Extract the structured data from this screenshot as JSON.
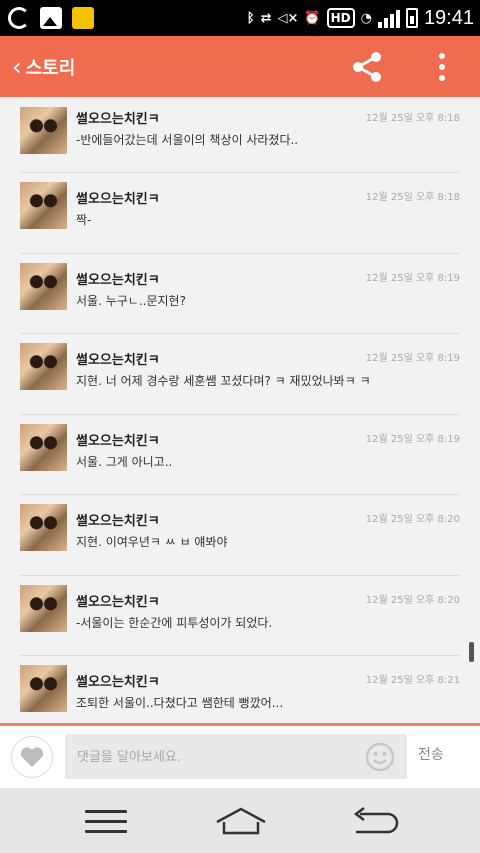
{
  "status_bar": {
    "hd_label": "HD",
    "time": "19:41",
    "icons": [
      "o-app-icon",
      "gallery-icon",
      "memo-icon",
      "bluetooth-icon",
      "nfc-icon",
      "mute-icon",
      "alarm-icon",
      "hd-icon",
      "wifi-icon",
      "signal-icon",
      "battery-charging-icon"
    ]
  },
  "app_bar": {
    "back_label": "스토리",
    "back_chevron": "‹",
    "share_icon": "share-icon",
    "more_icon": "more-vertical-icon"
  },
  "colors": {
    "accent": "#f06c4e",
    "background": "#f2f2f2"
  },
  "comments": [
    {
      "author": "썰오으는치킨ㅋ",
      "time": "12월 25일 오후 8:18",
      "text": "-반에들어갔는데 서울이의 책상이 사라졌다.."
    },
    {
      "author": "썰오으는치킨ㅋ",
      "time": "12월 25일 오후 8:18",
      "text": "짝-"
    },
    {
      "author": "썰오으는치킨ㅋ",
      "time": "12월 25일 오후 8:19",
      "text": "서울. 누구ㄴ..문지현?"
    },
    {
      "author": "썰오으는치킨ㅋ",
      "time": "12월 25일 오후 8:19",
      "text": "지현. 너 어제 경수랑 세훈쌤 꼬셨다며? ㅋ 재밌었나봐ㅋ ㅋ"
    },
    {
      "author": "썰오으는치킨ㅋ",
      "time": "12월 25일 오후 8:19",
      "text": "서울. 그게 아니고.."
    },
    {
      "author": "썰오으는치킨ㅋ",
      "time": "12월 25일 오후 8:20",
      "text": "지현. 이여우년ㅋ ㅆ ㅂ  얘봐야"
    },
    {
      "author": "썰오으는치킨ㅋ",
      "time": "12월 25일 오후 8:20",
      "text": "-서울이는 한순간에 피투성이가 되었다."
    },
    {
      "author": "썰오으는치킨ㅋ",
      "time": "12월 25일 오후 8:21",
      "text": "조퇴한 서울이..다쳤다고 쌤한테 뻥깠어..."
    }
  ],
  "composer": {
    "placeholder": "댓글을 달아보세요.",
    "send_label": "전송",
    "like_icon": "heart-icon",
    "emoji_icon": "smiley-icon"
  },
  "nav_bar": {
    "icons": [
      "menu-icon",
      "home-icon",
      "back-arrow-icon"
    ]
  }
}
